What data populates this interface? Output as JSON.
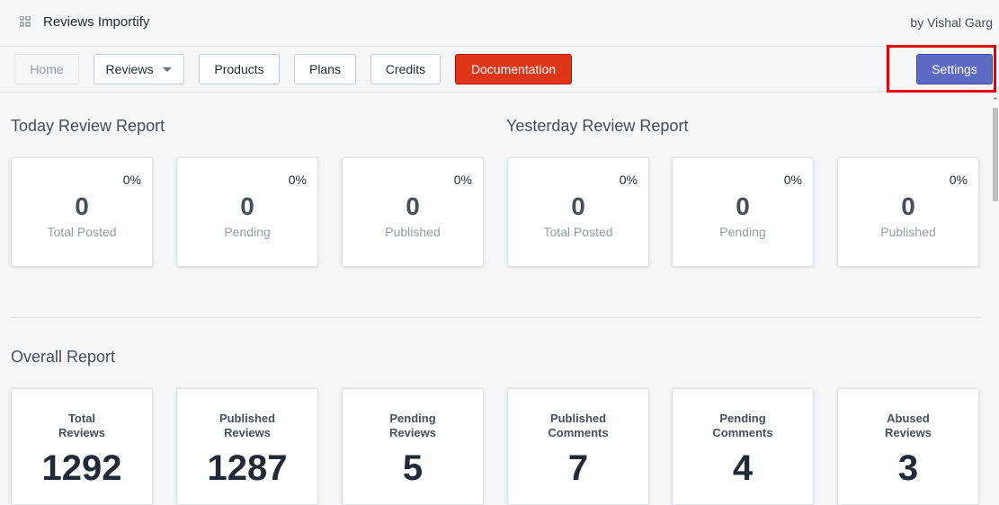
{
  "header": {
    "app_title": "Reviews Importify",
    "author": "by Vishal Garg",
    "app_icon": "apps-grid-icon"
  },
  "nav": {
    "home": "Home",
    "reviews": "Reviews",
    "products": "Products",
    "plans": "Plans",
    "credits": "Credits",
    "documentation": "Documentation",
    "settings": "Settings"
  },
  "today": {
    "title": "Today Review Report",
    "cards": [
      {
        "pct": "0%",
        "value": "0",
        "label": "Total Posted"
      },
      {
        "pct": "0%",
        "value": "0",
        "label": "Pending"
      },
      {
        "pct": "0%",
        "value": "0",
        "label": "Published"
      }
    ]
  },
  "yesterday": {
    "title": "Yesterday Review Report",
    "cards": [
      {
        "pct": "0%",
        "value": "0",
        "label": "Total Posted"
      },
      {
        "pct": "0%",
        "value": "0",
        "label": "Pending"
      },
      {
        "pct": "0%",
        "value": "0",
        "label": "Published"
      }
    ]
  },
  "overall": {
    "title": "Overall Report",
    "cards": [
      {
        "line1": "Total",
        "line2": "Reviews",
        "value": "1292"
      },
      {
        "line1": "Published",
        "line2": "Reviews",
        "value": "1287"
      },
      {
        "line1": "Pending",
        "line2": "Reviews",
        "value": "5"
      },
      {
        "line1": "Published",
        "line2": "Comments",
        "value": "7"
      },
      {
        "line1": "Pending",
        "line2": "Comments",
        "value": "4"
      },
      {
        "line1": "Abused",
        "line2": "Reviews",
        "value": "3"
      }
    ]
  },
  "colors": {
    "documentation_button": "#de3618",
    "settings_button": "#5c6ac4",
    "highlight_box": "#e8000b"
  }
}
